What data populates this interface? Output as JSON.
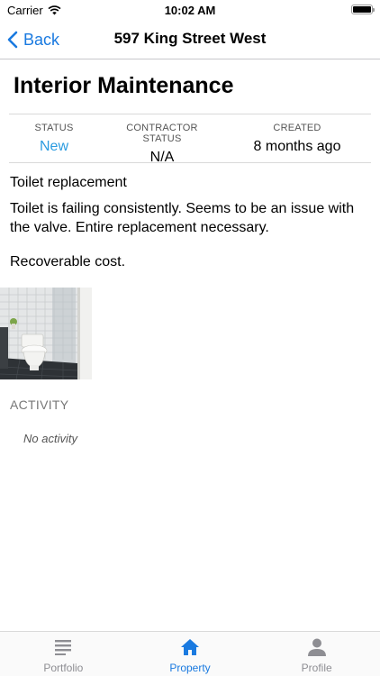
{
  "status_bar": {
    "carrier": "Carrier",
    "time": "10:02 AM"
  },
  "nav": {
    "back_label": "Back",
    "title": "597 King Street West"
  },
  "page": {
    "title": "Interior Maintenance"
  },
  "stats": [
    {
      "label": "STATUS",
      "value": "New",
      "value_color": "#2a9be0"
    },
    {
      "label": "CONTRACTOR STATUS",
      "value": "N/A"
    },
    {
      "label": "CREATED",
      "value": "8 months ago"
    }
  ],
  "issue": {
    "summary": "Toilet replacement",
    "description": "Toilet is failing consistently.  Seems to be an issue with the valve.  Entire replacement necessary.",
    "note": "Recoverable cost."
  },
  "activity": {
    "heading": "ACTIVITY",
    "empty_text": "No activity"
  },
  "tabs": [
    {
      "label": "Portfolio",
      "icon": "list-icon",
      "active": false
    },
    {
      "label": "Property",
      "icon": "home-icon",
      "active": true
    },
    {
      "label": "Profile",
      "icon": "person-icon",
      "active": false
    }
  ],
  "colors": {
    "accent": "#1a7ae0",
    "status_new": "#2a9be0"
  }
}
